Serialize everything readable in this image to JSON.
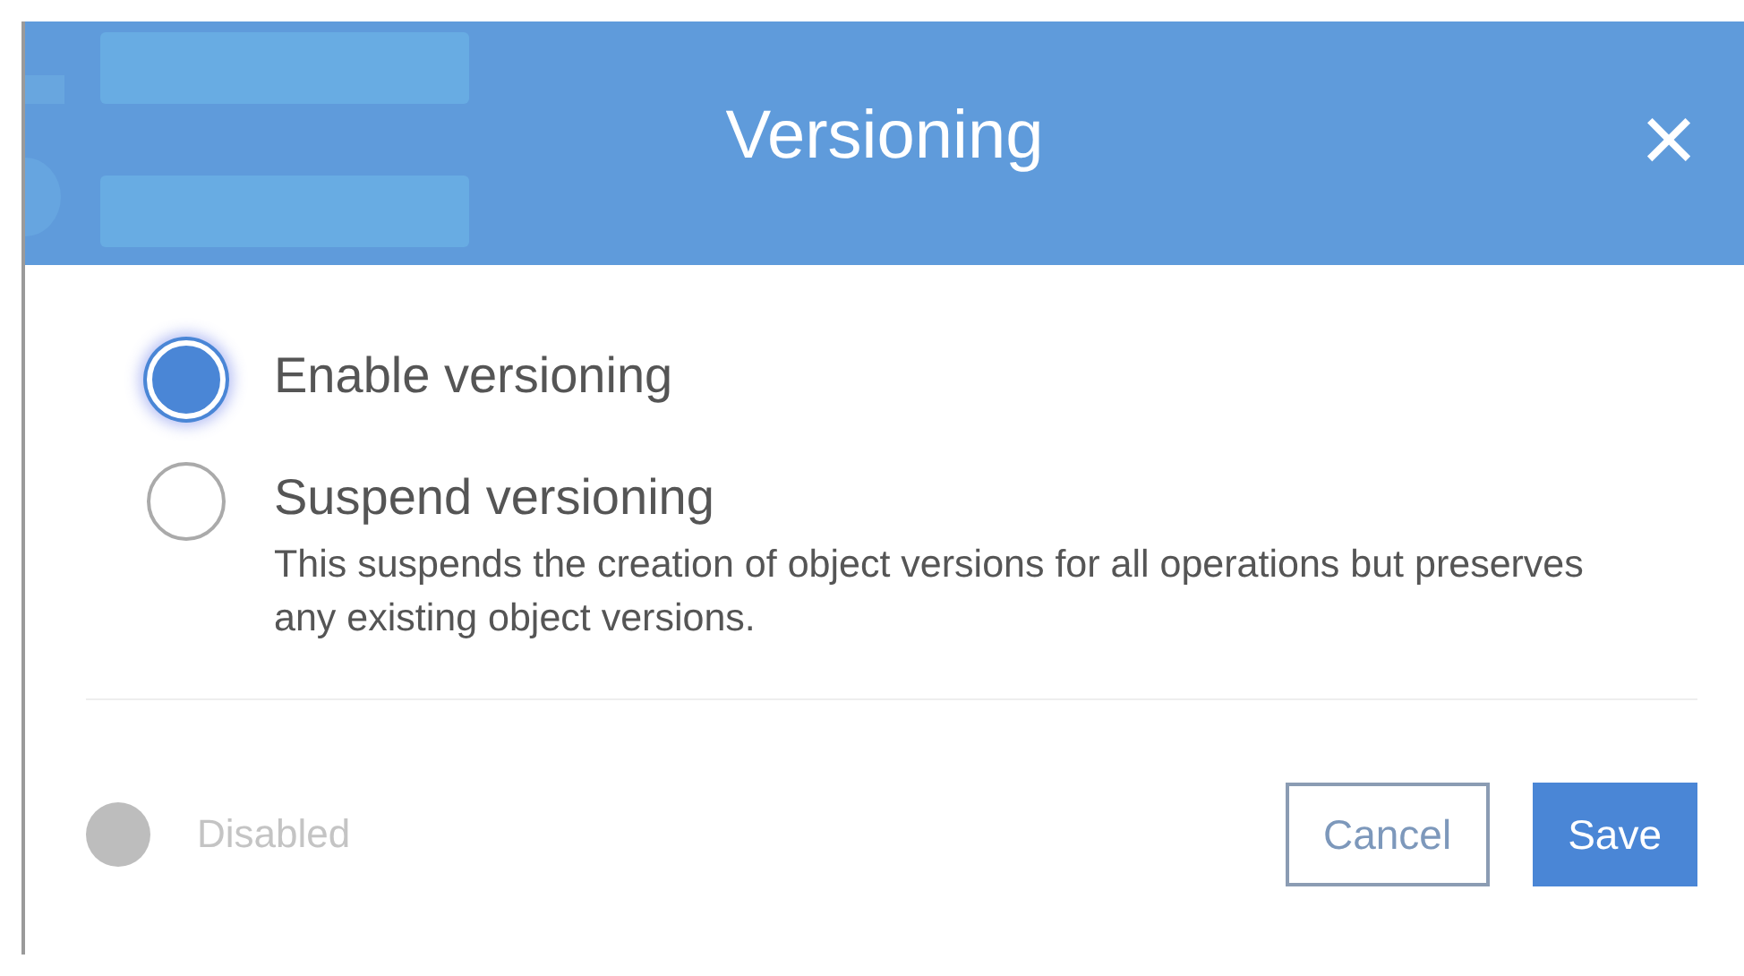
{
  "dialog": {
    "title": "Versioning",
    "close": "×"
  },
  "options": [
    {
      "label": "Enable versioning",
      "selected": true
    },
    {
      "label": "Suspend versioning",
      "selected": false,
      "description": "This suspends the creation of object versions for all operations but preserves any existing object versions."
    }
  ],
  "toggle": {
    "label": "Disabled",
    "disabled": true
  },
  "buttons": [
    {
      "label": "Cancel",
      "kind": "secondary"
    },
    {
      "label": "Save",
      "kind": "primary"
    }
  ]
}
